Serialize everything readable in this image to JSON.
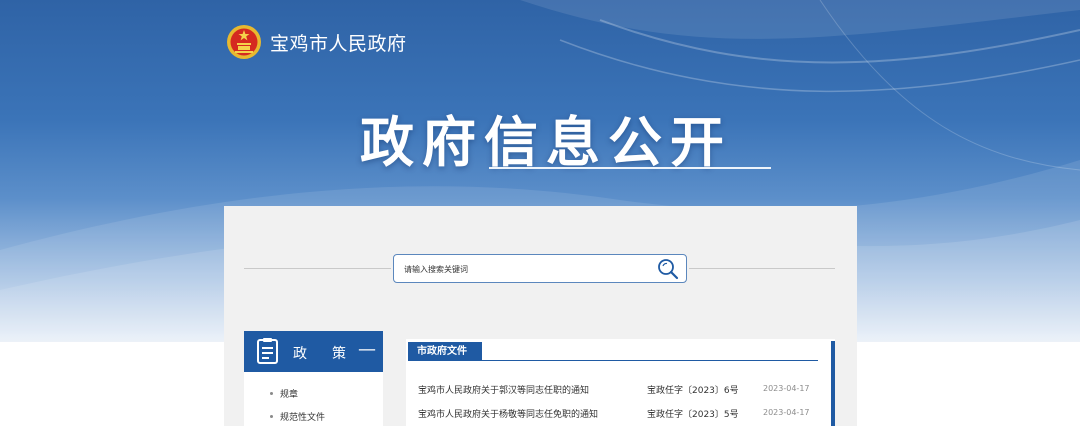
{
  "header": {
    "site_name": "宝鸡市人民政府",
    "emblem_icon": "national-emblem-icon",
    "page_title": "政府信息公开",
    "colors": {
      "banner_top": "#2f63a6",
      "accent": "#1f5aa3"
    }
  },
  "search": {
    "placeholder": "请输入搜索关键词",
    "button_icon": "search-icon"
  },
  "sidebar": {
    "heading_icon": "document-icon",
    "heading_part1": "政",
    "heading_part2": "策",
    "collapse_symbol": "—",
    "items": [
      {
        "label": "规章"
      },
      {
        "label": "规范性文件"
      }
    ]
  },
  "documents": {
    "tab_label": "市政府文件",
    "rows": [
      {
        "title": "宝鸡市人民政府关于郭汉等同志任职的通知",
        "number": "宝政任字〔2023〕6号",
        "date": "2023-04-17"
      },
      {
        "title": "宝鸡市人民政府关于杨敬等同志任免职的通知",
        "number": "宝政任字〔2023〕5号",
        "date": "2023-04-17"
      }
    ]
  }
}
